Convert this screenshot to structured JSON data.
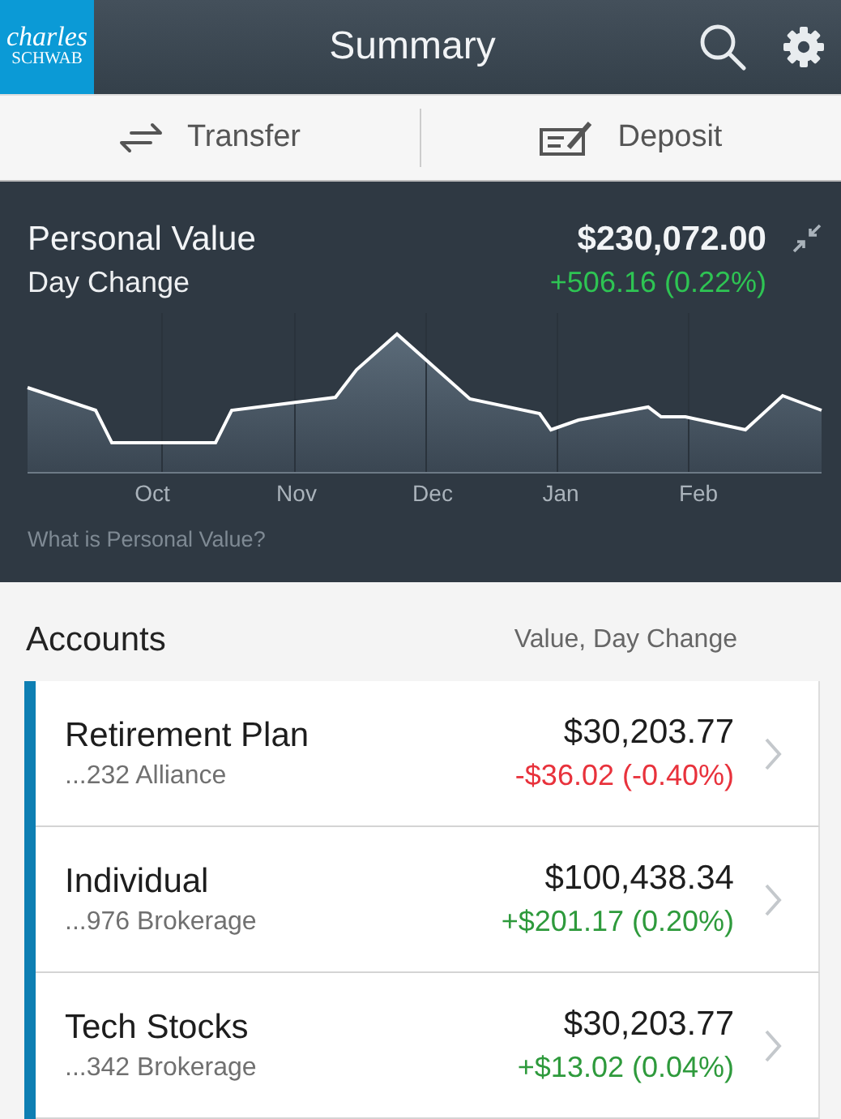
{
  "header": {
    "logo_line_1": "charles",
    "logo_line_2": "SCHWAB",
    "title": "Summary"
  },
  "actions": [
    {
      "label": "Transfer",
      "kind": "transfer"
    },
    {
      "label": "Deposit",
      "kind": "deposit"
    }
  ],
  "summary": {
    "label": "Personal Value",
    "value": "$230,072.00",
    "change_label": "Day Change",
    "change": "+506.16 (0.22%)",
    "color": "#2ec453",
    "months": [
      "Oct",
      "Nov",
      "Dec",
      "Jan",
      "Feb"
    ],
    "help_link": "What is Personal Value?"
  },
  "accounts": {
    "title": "Accounts",
    "column_label": "Value, Day Change",
    "items": [
      {
        "name": "Retirement Plan",
        "number": "...232 Alliance",
        "value": "$30,203.77",
        "change": "-$36.02 (-0.40%)",
        "color": "#e8323c"
      },
      {
        "name": "Individual",
        "number": "...976 Brokerage",
        "value": "$100,438.34",
        "change": "+$201.17 (0.20%)",
        "color": "#2e9a3c"
      },
      {
        "name": "Tech Stocks",
        "number": "...342 Brokerage",
        "value": "$30,203.77",
        "change": "+$13.02 (0.04%)",
        "color": "#2e9a3c"
      }
    ]
  }
}
